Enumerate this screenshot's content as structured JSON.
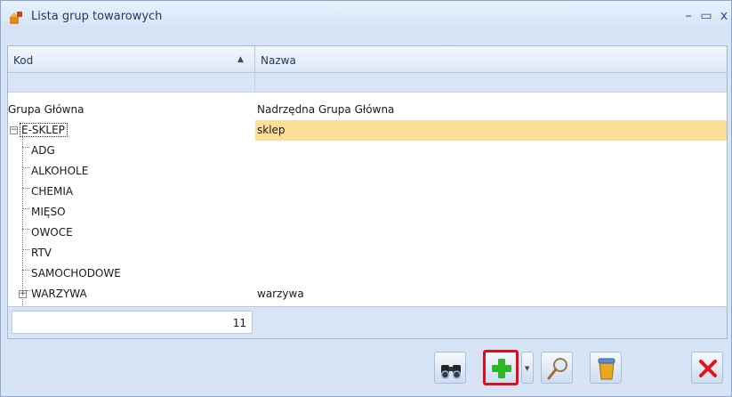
{
  "window": {
    "title": "Lista grup towarowych",
    "minimize": "–",
    "maximize": "▭",
    "close": "x"
  },
  "columns": {
    "kod": "Kod",
    "nazwa": "Nazwa"
  },
  "rows": [
    {
      "kod": "Grupa Główna",
      "nazwa": "Nadrzędna Grupa Główna"
    },
    {
      "kod": "E-SKLEP",
      "nazwa": "sklep",
      "selected": true
    },
    {
      "kod": "ADG",
      "nazwa": ""
    },
    {
      "kod": "ALKOHOLE",
      "nazwa": ""
    },
    {
      "kod": "CHEMIA",
      "nazwa": ""
    },
    {
      "kod": "MIĘSO",
      "nazwa": ""
    },
    {
      "kod": "OWOCE",
      "nazwa": ""
    },
    {
      "kod": "RTV",
      "nazwa": ""
    },
    {
      "kod": "SAMOCHODOWE",
      "nazwa": ""
    },
    {
      "kod": "WARZYWA",
      "nazwa": "warzywa"
    }
  ],
  "footer": {
    "count": "11"
  },
  "toolbar": {
    "icons": [
      "binoculars-icon",
      "plus-icon",
      "magnifier-icon",
      "trash-bin-icon",
      "close-x-icon"
    ]
  },
  "colors": {
    "selection": "#fbdf98",
    "highlight_border": "#e10c1b",
    "plus_green": "#2fb52a",
    "close_red": "#e01818"
  }
}
